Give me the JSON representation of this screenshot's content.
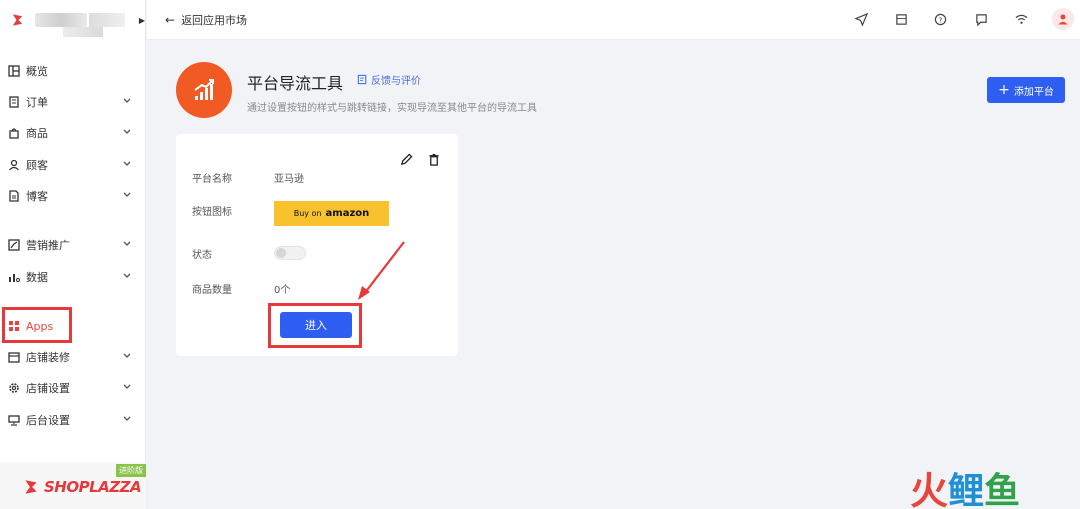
{
  "sidebar": {
    "nav": [
      {
        "label": "概览",
        "icon": "dashboard-icon",
        "chevron": false
      },
      {
        "label": "订单",
        "icon": "order-icon",
        "chevron": true
      },
      {
        "label": "商品",
        "icon": "bag-icon",
        "chevron": true
      },
      {
        "label": "顾客",
        "icon": "user-icon",
        "chevron": true
      },
      {
        "label": "博客",
        "icon": "blog-icon",
        "chevron": true
      },
      {
        "label": "营销推广",
        "icon": "marketing-icon",
        "chevron": true
      },
      {
        "label": "数据",
        "icon": "chart-icon",
        "chevron": true
      },
      {
        "label": "Apps",
        "icon": "apps-icon",
        "chevron": false
      },
      {
        "label": "店铺装修",
        "icon": "store-design-icon",
        "chevron": true
      },
      {
        "label": "店铺设置",
        "icon": "gear-icon",
        "chevron": true
      },
      {
        "label": "后台设置",
        "icon": "monitor-icon",
        "chevron": true
      }
    ],
    "brand_tag": "进阶版",
    "brand_name": "SHOPLAZZA"
  },
  "topbar": {
    "back_label": "返回应用市场",
    "icons": [
      "send-icon",
      "store-icon",
      "help-icon",
      "message-icon",
      "wifi-icon",
      "avatar-icon"
    ]
  },
  "app": {
    "title": "平台导流工具",
    "feedback_label": "反馈与评价",
    "description": "通过设置按钮的样式与跳转链接，实现导流至其他平台的导流工具",
    "add_button": "添加平台"
  },
  "card": {
    "platform_name_label": "平台名称",
    "platform_name_value": "亚马逊",
    "button_icon_label": "按钮图标",
    "amazon_prefix": "Buy on",
    "amazon_word": "amazon",
    "status_label": "状态",
    "status_on": false,
    "product_count_label": "商品数量",
    "product_count_value": "0个",
    "enter_button": "进入"
  },
  "watermark": {
    "c1": "火",
    "c2": "鲤",
    "c3": "鱼"
  },
  "colors": {
    "accent": "#2f5ff2",
    "brand_red": "#e5393e",
    "app_orange": "#f15a22"
  }
}
